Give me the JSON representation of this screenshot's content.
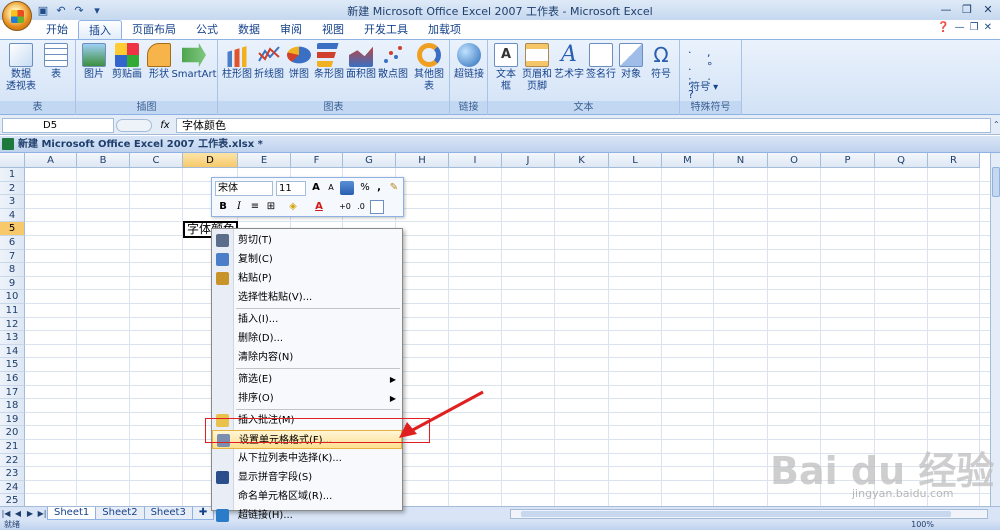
{
  "window": {
    "title": "新建 Microsoft Office Excel 2007 工作表 - Microsoft Excel"
  },
  "tabs": [
    "开始",
    "插入",
    "页面布局",
    "公式",
    "数据",
    "审阅",
    "视图",
    "开发工具",
    "加载项"
  ],
  "active_tab": "插入",
  "ribbon": {
    "groups": [
      {
        "label": "表",
        "buttons": [
          "数据\n透视表",
          "表"
        ]
      },
      {
        "label": "插图",
        "buttons": [
          "图片",
          "剪贴画",
          "形状",
          "SmartArt"
        ]
      },
      {
        "label": "图表",
        "buttons": [
          "柱形图",
          "折线图",
          "饼图",
          "条形图",
          "面积图",
          "散点图",
          "其他图表"
        ]
      },
      {
        "label": "链接",
        "buttons": [
          "超链接"
        ]
      },
      {
        "label": "文本",
        "buttons": [
          "文本框",
          "页眉和\n页脚",
          "艺术字",
          "签名行",
          "对象",
          "符号"
        ]
      },
      {
        "label": "特殊符号",
        "buttons": [
          "符号"
        ]
      }
    ],
    "special_symbols": "· , . ° ; : ?"
  },
  "formula_bar": {
    "name_box": "D5",
    "fx": "fx",
    "content": "字体颜色"
  },
  "workbook_title": "新建 Microsoft Office Excel 2007 工作表.xlsx *",
  "columns": [
    "A",
    "B",
    "C",
    "D",
    "E",
    "F",
    "G",
    "H",
    "I",
    "J",
    "K",
    "L",
    "M",
    "N",
    "O",
    "P",
    "Q",
    "R"
  ],
  "rows": [
    "1",
    "2",
    "3",
    "4",
    "5",
    "6",
    "7",
    "8",
    "9",
    "10",
    "11",
    "12",
    "13",
    "14",
    "15",
    "16",
    "17",
    "18",
    "19",
    "20",
    "21",
    "22",
    "23",
    "24",
    "25"
  ],
  "selected_cell": {
    "ref": "D5",
    "value": "字体颜色"
  },
  "mini_toolbar": {
    "font": "宋体",
    "size": "11"
  },
  "context_menu": [
    {
      "label": "剪切(T)",
      "icon": "scissors-icon"
    },
    {
      "label": "复制(C)",
      "icon": "copy-icon"
    },
    {
      "label": "粘贴(P)",
      "icon": "paste-icon"
    },
    {
      "label": "选择性粘贴(V)...",
      "icon": ""
    },
    {
      "sep": true
    },
    {
      "label": "插入(I)...",
      "icon": ""
    },
    {
      "label": "删除(D)...",
      "icon": ""
    },
    {
      "label": "清除内容(N)",
      "icon": ""
    },
    {
      "sep": true
    },
    {
      "label": "筛选(E)",
      "icon": "",
      "sub": true
    },
    {
      "label": "排序(O)",
      "icon": "",
      "sub": true
    },
    {
      "sep": true
    },
    {
      "label": "插入批注(M)",
      "icon": "comment-icon"
    },
    {
      "label": "设置单元格格式(F)...",
      "icon": "format-cells-icon",
      "highlight": true
    },
    {
      "label": "从下拉列表中选择(K)...",
      "icon": ""
    },
    {
      "label": "显示拼音字段(S)",
      "icon": "phonetic-icon"
    },
    {
      "label": "命名单元格区域(R)...",
      "icon": ""
    },
    {
      "label": "超链接(H)...",
      "icon": "hyperlink-icon"
    }
  ],
  "sheets": [
    "Sheet1",
    "Sheet2",
    "Sheet3"
  ],
  "status": {
    "mode": "就绪",
    "zoom": "100%"
  },
  "watermark": {
    "main": "Bai du 经验",
    "sub": "jingyan.baidu.com"
  }
}
